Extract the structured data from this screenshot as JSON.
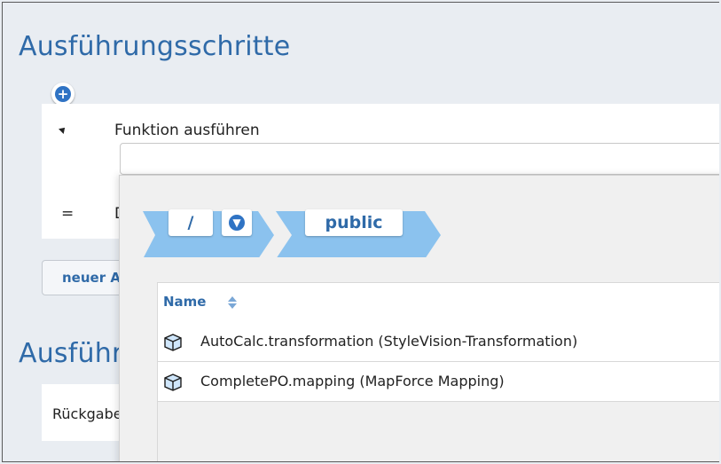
{
  "sections": {
    "steps_title": "Ausführungsschritte",
    "result_title": "Ausführungsergebnis"
  },
  "step": {
    "label": "Funktion ausführen",
    "input_value": "",
    "second_row_marker": "=",
    "second_row_text": "D"
  },
  "buttons": {
    "add": "+",
    "new_step": "neuer Ausführungsschritt"
  },
  "result": {
    "label": "Rückgabewert"
  },
  "browser": {
    "root_label": "/",
    "current_folder": "public",
    "column_header": "Name",
    "items": [
      {
        "label": "AutoCalc.transformation (StyleVision-Transformation)",
        "icon": "cube-icon"
      },
      {
        "label": "CompletePO.mapping (MapForce Mapping)",
        "icon": "cube-icon"
      }
    ]
  },
  "colors": {
    "accent": "#2f6aa8",
    "breadcrumb": "#8bc2ee",
    "background": "#e9edf2"
  }
}
